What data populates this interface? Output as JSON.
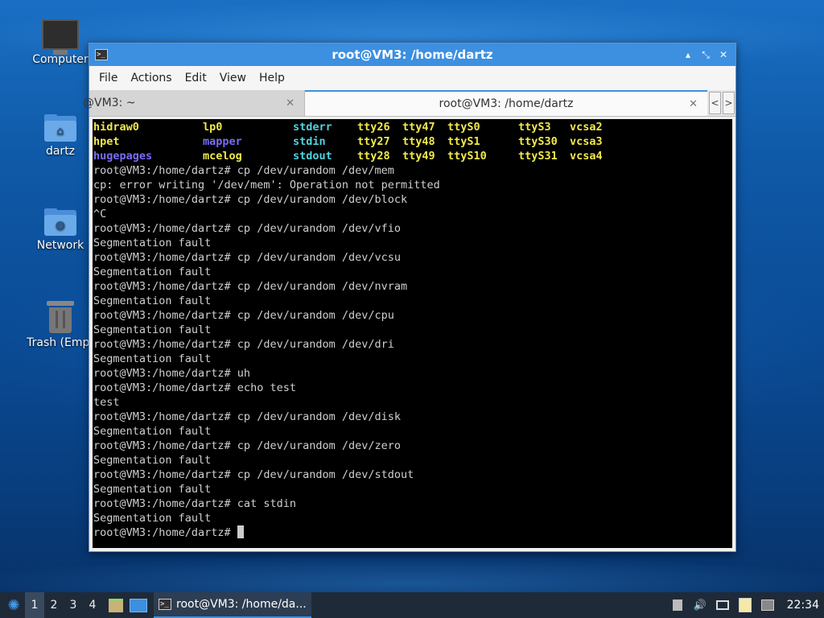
{
  "desktop": {
    "icons": [
      {
        "label": "Computer"
      },
      {
        "label": "dartz"
      },
      {
        "label": "Network"
      },
      {
        "label": "Trash (Empt"
      }
    ]
  },
  "window": {
    "title": "root@VM3: /home/dartz",
    "title_icon": ">_",
    "controls": {
      "minimize": "▴",
      "maximize": "⤡",
      "close": "✕"
    },
    "menu": [
      "File",
      "Actions",
      "Edit",
      "View",
      "Help"
    ],
    "tabs": [
      {
        "label": "@VM3: ~",
        "close": "✕"
      },
      {
        "label": "root@VM3: /home/dartz",
        "close": "✕"
      }
    ],
    "tab_nav": {
      "left": "<",
      "right": ">"
    }
  },
  "terminal": {
    "ls_rows": [
      [
        [
          "hidraw0",
          "yellow"
        ],
        [
          "lp0",
          "yellow"
        ],
        [
          "stderr",
          "cyan"
        ],
        [
          "tty26",
          "yellow"
        ],
        [
          "tty47",
          "yellow"
        ],
        [
          "ttyS0",
          "yellow"
        ],
        [
          "ttyS3",
          "yellow"
        ],
        [
          "vcsa2",
          "yellow"
        ]
      ],
      [
        [
          "hpet",
          "yellow"
        ],
        [
          "mapper",
          "blue"
        ],
        [
          "stdin",
          "cyan"
        ],
        [
          "tty27",
          "yellow"
        ],
        [
          "tty48",
          "yellow"
        ],
        [
          "ttyS1",
          "yellow"
        ],
        [
          "ttyS30",
          "yellow"
        ],
        [
          "vcsa3",
          "yellow"
        ]
      ],
      [
        [
          "hugepages",
          "blue"
        ],
        [
          "mcelog",
          "yellow"
        ],
        [
          "stdout",
          "cyan"
        ],
        [
          "tty28",
          "yellow"
        ],
        [
          "tty49",
          "yellow"
        ],
        [
          "ttyS10",
          "yellow"
        ],
        [
          "ttyS31",
          "yellow"
        ],
        [
          "vcsa4",
          "yellow"
        ]
      ]
    ],
    "lines": [
      "root@VM3:/home/dartz# cp /dev/urandom /dev/mem",
      "cp: error writing '/dev/mem': Operation not permitted",
      "root@VM3:/home/dartz# cp /dev/urandom /dev/block",
      "^C",
      "root@VM3:/home/dartz# cp /dev/urandom /dev/vfio",
      "Segmentation fault",
      "root@VM3:/home/dartz# cp /dev/urandom /dev/vcsu",
      "Segmentation fault",
      "root@VM3:/home/dartz# cp /dev/urandom /dev/nvram",
      "Segmentation fault",
      "root@VM3:/home/dartz# cp /dev/urandom /dev/cpu",
      "Segmentation fault",
      "root@VM3:/home/dartz# cp /dev/urandom /dev/dri",
      "Segmentation fault",
      "root@VM3:/home/dartz# uh",
      "root@VM3:/home/dartz# echo test",
      "test",
      "root@VM3:/home/dartz# cp /dev/urandom /dev/disk",
      "Segmentation fault",
      "root@VM3:/home/dartz# cp /dev/urandom /dev/zero",
      "Segmentation fault",
      "root@VM3:/home/dartz# cp /dev/urandom /dev/stdout",
      "Segmentation fault",
      "root@VM3:/home/dartz# cat stdin",
      "Segmentation fault"
    ],
    "prompt": "root@VM3:/home/dartz# ",
    "colors": {
      "yellow": "#f0e94a",
      "cyan": "#4fd3e0",
      "blue": "#7b6cf6"
    }
  },
  "taskbar": {
    "workspaces": [
      "1",
      "2",
      "3",
      "4"
    ],
    "active_workspace": "1",
    "task_label": "root@VM3: /home/da...",
    "clock": "22:34"
  }
}
